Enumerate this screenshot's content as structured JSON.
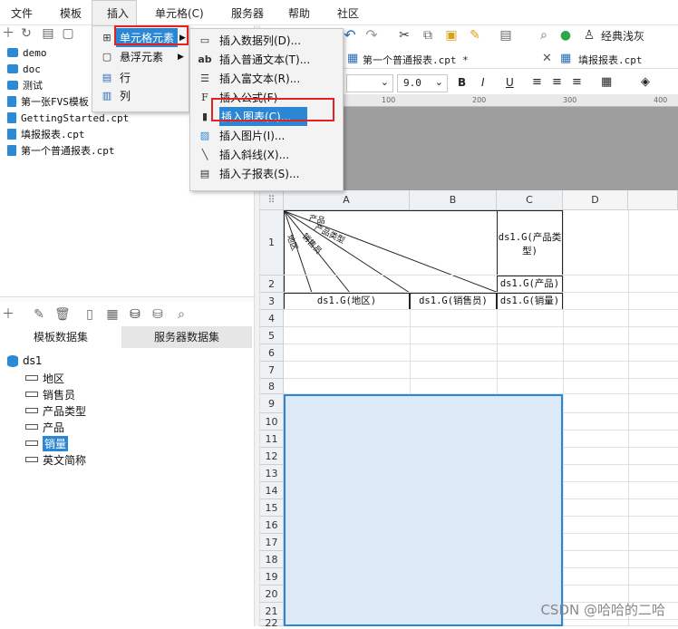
{
  "menubar": {
    "items": [
      "文件",
      "模板",
      "插入",
      "单元格(C)",
      "服务器",
      "帮助",
      "社区"
    ]
  },
  "file_tree": [
    {
      "name": "demo",
      "type": "folder"
    },
    {
      "name": "doc",
      "type": "folder"
    },
    {
      "name": "测试",
      "type": "folder"
    },
    {
      "name": "第一张FVS模板",
      "type": "file"
    },
    {
      "name": "GettingStarted.cpt",
      "type": "file"
    },
    {
      "name": "填报报表.cpt",
      "type": "file"
    },
    {
      "name": "第一个普通报表.cpt",
      "type": "file"
    }
  ],
  "dataset_tabs": [
    "模板数据集",
    "服务器数据集"
  ],
  "dataset": {
    "name": "ds1",
    "fields": [
      "地区",
      "销售员",
      "产品类型",
      "产品",
      "销量",
      "英文简称"
    ],
    "selected_field": "销量"
  },
  "main_toolbar": {
    "style_label": "经典浅灰"
  },
  "doc_tabs": [
    "第一个普通报表.cpt *",
    "填报报表.cpt"
  ],
  "format": {
    "font_size": "9.0",
    "bold": "B",
    "italic": "I",
    "underline": "U"
  },
  "ruler_marks": [
    "100",
    "200",
    "300",
    "400"
  ],
  "grid": {
    "columns": [
      "A",
      "B",
      "C",
      "D"
    ],
    "rows": [
      "1",
      "2",
      "3",
      "4",
      "5",
      "6",
      "7",
      "8",
      "9",
      "10",
      "11",
      "12",
      "13",
      "14",
      "15",
      "16",
      "17",
      "18",
      "19",
      "20",
      "21",
      "22"
    ],
    "cells": {
      "header_labels": [
        "产品",
        "产品类型",
        "销售员",
        "地区"
      ],
      "c1": "ds1.G(产品类型)",
      "c2": "ds1.G(产品)",
      "a3": "ds1.G(地区)",
      "b3": "ds1.G(销售员)",
      "c3": "ds1.G(销量)"
    }
  },
  "insert_menu": {
    "items": [
      "单元格元素",
      "悬浮元素",
      "行",
      "列"
    ]
  },
  "cell_element_submenu": {
    "items": [
      {
        "label": "插入数据列(D)...",
        "icon": "data-column-icon"
      },
      {
        "label": "插入普通文本(T)...",
        "icon": "text-icon"
      },
      {
        "label": "插入富文本(R)...",
        "icon": "rich-text-icon"
      },
      {
        "label": "插入公式(F)",
        "icon": "formula-icon"
      },
      {
        "label": "插入图表(C)...",
        "icon": "chart-icon"
      },
      {
        "label": "插入图片(I)...",
        "icon": "image-icon"
      },
      {
        "label": "插入斜线(X)...",
        "icon": "slash-icon"
      },
      {
        "label": "插入子报表(S)...",
        "icon": "subreport-icon"
      }
    ],
    "highlighted": "插入图表(C)..."
  },
  "watermark": "CSDN @哈哈的二哈"
}
